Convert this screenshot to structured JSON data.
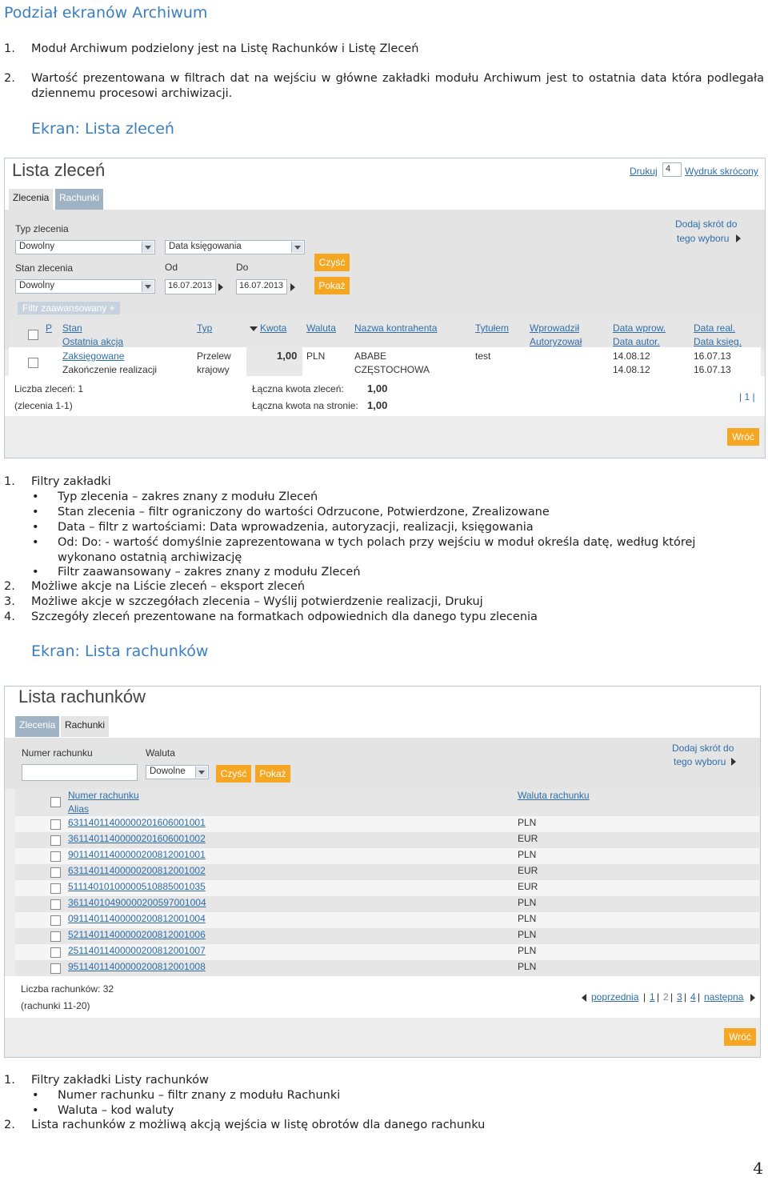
{
  "doc": {
    "title": "Podział ekranów Archiwum",
    "intro": [
      {
        "num": "1.",
        "text": "Moduł Archiwum podzielony jest na Listę Rachunków i Listę Zleceń"
      },
      {
        "num": "2.",
        "text": "Wartość prezentowana w filtrach dat na wejściu w główne zakładki modułu Archiwum jest to ostatnia data która podlegała dziennemu procesowi archiwizacji."
      }
    ],
    "section1_title": "Ekran: Lista zleceń",
    "section1_list": {
      "item1": {
        "num": "1.",
        "text": "Filtry zakładki"
      },
      "bullets": [
        {
          "dot": "•",
          "text": "Typ zlecenia – zakres znany z modułu Zleceń"
        },
        {
          "dot": "•",
          "text": "Stan zlecenia – filtr ograniczony do wartości Odrzucone, Potwierdzone, Zrealizowane"
        },
        {
          "dot": "•",
          "text": "Data – filtr z wartościami: Data wprowadzenia, autoryzacji, realizacji, księgowania"
        },
        {
          "dot": "•",
          "text": "Od: Do: - wartość domyślnie zaprezentowana w tych polach przy wejściu w moduł określa datę, według której wykonano ostatnią archiwizację"
        },
        {
          "dot": "•",
          "text": "Filtr zaawansowany – zakres znany z modułu Zleceń"
        }
      ],
      "rest": [
        {
          "num": "2.",
          "text": "Możliwe akcje na Liście zleceń – eksport zleceń"
        },
        {
          "num": "3.",
          "text": "Możliwe akcje w szczegółach zlecenia – Wyślij potwierdzenie realizacji, Drukuj"
        },
        {
          "num": "4.",
          "text": "Szczegóły zleceń prezentowane na formatkach odpowiednich dla danego typu zlecenia"
        }
      ]
    },
    "section2_title": "Ekran: Lista rachunków",
    "section2_list": {
      "item1": {
        "num": "1.",
        "text": "Filtry zakładki Listy rachunków"
      },
      "bullets": [
        {
          "dot": "•",
          "text": "Numer rachunku – filtr znany z modułu Rachunki"
        },
        {
          "dot": "•",
          "text": "Waluta – kod waluty"
        }
      ],
      "item2": {
        "num": "2.",
        "text": "Lista rachunków z możliwą akcją wejścia w listę obrotów dla danego rachunku"
      }
    },
    "page_number": "4"
  },
  "orders_screen": {
    "title": "Lista zleceń",
    "print_link": "Drukuj",
    "print_copies": "4",
    "print_short_link": "Wydruk skrócony",
    "tabs": [
      "Zlecenia",
      "Rachunki"
    ],
    "shortcut_line1": "Dodaj skrót do",
    "shortcut_line2": "tego wyboru",
    "filters": {
      "type_label": "Typ zlecenia",
      "type_value": "Dowolny",
      "date_kind_value": "Data księgowania",
      "state_label": "Stan zlecenia",
      "state_value": "Dowolny",
      "from_label": "Od",
      "from_value": "16.07.2013",
      "to_label": "Do",
      "to_value": "16.07.2013",
      "clear_btn": "Czyść",
      "show_btn": "Pokaż",
      "advanced": "Filtr zaawansowany +"
    },
    "columns": {
      "p": "P",
      "state": "Stan",
      "last_action": "Ostatnia akcja",
      "type": "Typ",
      "amount": "Kwota",
      "currency": "Waluta",
      "counterparty": "Nazwa kontrahenta",
      "title": "Tytułem",
      "entered": "Wprowadził",
      "authorized": "Autoryzował",
      "date_entered": "Data wprow.",
      "date_auth": "Data autor.",
      "date_real": "Data real.",
      "date_booked": "Data księg."
    },
    "row": {
      "state": "Zaksięgowane",
      "last_action": "Zakończenie realizacji",
      "type1": "Przelew",
      "type2": "krajowy",
      "amount": "1,00",
      "currency": "PLN",
      "counterparty1": "ABABE",
      "counterparty2": "CZĘSTOCHOWA",
      "title": "test",
      "date_entered": "14.08.12",
      "date_auth": "14.08.12",
      "date_real": "16.07.13",
      "date_booked": "16.07.13"
    },
    "summary": {
      "count_label": "Liczba zleceń: 1",
      "range_label": "(zlecenia 1-1)",
      "total_label": "Łączna kwota zleceń:",
      "total_value": "1,00",
      "page_total_label": "Łączna kwota na stronie:",
      "page_total_value": "1,00",
      "pager": "| 1 |"
    },
    "back_btn": "Wróć"
  },
  "accounts_screen": {
    "title": "Lista rachunków",
    "tabs": [
      "Zlecenia",
      "Rachunki"
    ],
    "shortcut_line1": "Dodaj skrót do",
    "shortcut_line2": "tego wyboru",
    "filters": {
      "number_label": "Numer rachunku",
      "number_value": "",
      "currency_label": "Waluta",
      "currency_value": "Dowolne",
      "clear_btn": "Czyść",
      "show_btn": "Pokaż"
    },
    "columns": {
      "number": "Numer rachunku",
      "alias": "Alias",
      "currency": "Waluta rachunku"
    },
    "rows": [
      {
        "number": "63114011400000201606001001",
        "currency": "PLN"
      },
      {
        "number": "36114011400000201606001002",
        "currency": "EUR"
      },
      {
        "number": "90114011400000200812001001",
        "currency": "PLN"
      },
      {
        "number": "63114011400000200812001002",
        "currency": "EUR"
      },
      {
        "number": "51114010100000510885001035",
        "currency": "EUR"
      },
      {
        "number": "36114010490000200597001004",
        "currency": "PLN"
      },
      {
        "number": "09114011400000200812001004",
        "currency": "PLN"
      },
      {
        "number": "52114011400000200812001006",
        "currency": "PLN"
      },
      {
        "number": "25114011400000200812001007",
        "currency": "PLN"
      },
      {
        "number": "95114011400000200812001008",
        "currency": "PLN"
      }
    ],
    "summary": {
      "count_label": "Liczba rachunków: 32",
      "range_label": "(rachunki 11-20)"
    },
    "pager": {
      "prev": "poprzednia",
      "pages": [
        "1",
        "2",
        "3",
        "4"
      ],
      "next": "następna"
    },
    "back_btn": "Wróć"
  }
}
